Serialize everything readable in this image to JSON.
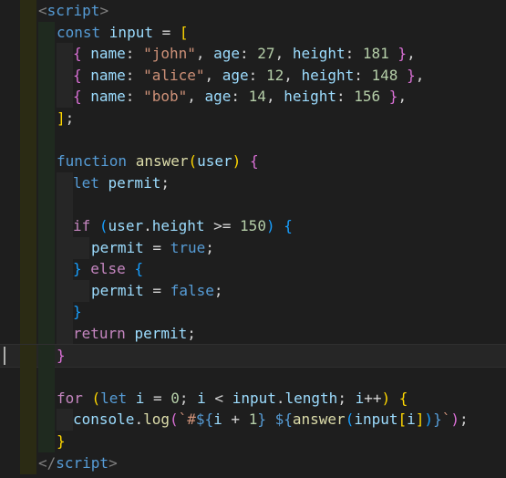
{
  "editor": {
    "lines": [
      {
        "tokens": [
          [
            "tag",
            "<"
          ],
          [
            "kw",
            "script"
          ],
          [
            "tag",
            ">"
          ]
        ]
      },
      {
        "tokens": [
          [
            "kw",
            "const "
          ],
          [
            "var",
            "input"
          ],
          [
            "op",
            " = "
          ],
          [
            "b1",
            "["
          ]
        ]
      },
      {
        "tokens": [
          [
            "b2",
            "{ "
          ],
          [
            "var",
            "name"
          ],
          [
            "op",
            ": "
          ],
          [
            "str",
            "\"john\""
          ],
          [
            "op",
            ", "
          ],
          [
            "var",
            "age"
          ],
          [
            "op",
            ": "
          ],
          [
            "num",
            "27"
          ],
          [
            "op",
            ", "
          ],
          [
            "var",
            "height"
          ],
          [
            "op",
            ": "
          ],
          [
            "num",
            "181"
          ],
          [
            "b2",
            " }"
          ],
          [
            "op",
            ","
          ]
        ]
      },
      {
        "tokens": [
          [
            "b2",
            "{ "
          ],
          [
            "var",
            "name"
          ],
          [
            "op",
            ": "
          ],
          [
            "str",
            "\"alice\""
          ],
          [
            "op",
            ", "
          ],
          [
            "var",
            "age"
          ],
          [
            "op",
            ": "
          ],
          [
            "num",
            "12"
          ],
          [
            "op",
            ", "
          ],
          [
            "var",
            "height"
          ],
          [
            "op",
            ": "
          ],
          [
            "num",
            "148"
          ],
          [
            "b2",
            " }"
          ],
          [
            "op",
            ","
          ]
        ]
      },
      {
        "tokens": [
          [
            "b2",
            "{ "
          ],
          [
            "var",
            "name"
          ],
          [
            "op",
            ": "
          ],
          [
            "str",
            "\"bob\""
          ],
          [
            "op",
            ", "
          ],
          [
            "var",
            "age"
          ],
          [
            "op",
            ": "
          ],
          [
            "num",
            "14"
          ],
          [
            "op",
            ", "
          ],
          [
            "var",
            "height"
          ],
          [
            "op",
            ": "
          ],
          [
            "num",
            "156"
          ],
          [
            "b2",
            " }"
          ],
          [
            "op",
            ","
          ]
        ]
      },
      {
        "tokens": [
          [
            "b1",
            "]"
          ],
          [
            "op",
            ";"
          ]
        ]
      },
      {
        "tokens": []
      },
      {
        "tokens": [
          [
            "kw",
            "function "
          ],
          [
            "fn",
            "answer"
          ],
          [
            "b1",
            "("
          ],
          [
            "var",
            "user"
          ],
          [
            "b1",
            ")"
          ],
          [
            "op",
            " "
          ],
          [
            "b2",
            "{"
          ]
        ]
      },
      {
        "tokens": [
          [
            "kw",
            "let "
          ],
          [
            "var",
            "permit"
          ],
          [
            "op",
            ";"
          ]
        ]
      },
      {
        "tokens": []
      },
      {
        "tokens": [
          [
            "ctrl",
            "if "
          ],
          [
            "b3",
            "("
          ],
          [
            "var",
            "user"
          ],
          [
            "op",
            "."
          ],
          [
            "var",
            "height"
          ],
          [
            "op",
            " >= "
          ],
          [
            "num",
            "150"
          ],
          [
            "b3",
            ")"
          ],
          [
            "op",
            " "
          ],
          [
            "b3",
            "{"
          ]
        ]
      },
      {
        "tokens": [
          [
            "var",
            "permit"
          ],
          [
            "op",
            " = "
          ],
          [
            "kw",
            "true"
          ],
          [
            "op",
            ";"
          ]
        ]
      },
      {
        "tokens": [
          [
            "b3",
            "}"
          ],
          [
            "op",
            " "
          ],
          [
            "ctrl",
            "else "
          ],
          [
            "b3",
            "{"
          ]
        ]
      },
      {
        "tokens": [
          [
            "var",
            "permit"
          ],
          [
            "op",
            " = "
          ],
          [
            "kw",
            "false"
          ],
          [
            "op",
            ";"
          ]
        ]
      },
      {
        "tokens": [
          [
            "b3",
            "}"
          ]
        ]
      },
      {
        "tokens": [
          [
            "ctrl",
            "return "
          ],
          [
            "var",
            "permit"
          ],
          [
            "op",
            ";"
          ]
        ]
      },
      {
        "tokens": [
          [
            "b2",
            "}"
          ]
        ]
      },
      {
        "tokens": []
      },
      {
        "tokens": [
          [
            "ctrl",
            "for "
          ],
          [
            "b1",
            "("
          ],
          [
            "kw",
            "let "
          ],
          [
            "var",
            "i"
          ],
          [
            "op",
            " = "
          ],
          [
            "num",
            "0"
          ],
          [
            "op",
            "; "
          ],
          [
            "var",
            "i"
          ],
          [
            "op",
            " < "
          ],
          [
            "var",
            "input"
          ],
          [
            "op",
            "."
          ],
          [
            "var",
            "length"
          ],
          [
            "op",
            "; "
          ],
          [
            "var",
            "i"
          ],
          [
            "op",
            "++"
          ],
          [
            "b1",
            ")"
          ],
          [
            "op",
            " "
          ],
          [
            "b1",
            "{"
          ]
        ]
      },
      {
        "tokens": [
          [
            "var",
            "console"
          ],
          [
            "op",
            "."
          ],
          [
            "fn",
            "log"
          ],
          [
            "b2",
            "("
          ],
          [
            "str",
            "`#"
          ],
          [
            "kw",
            "${"
          ],
          [
            "var",
            "i"
          ],
          [
            "op",
            " + "
          ],
          [
            "num",
            "1"
          ],
          [
            "kw",
            "}"
          ],
          [
            "str",
            " "
          ],
          [
            "kw",
            "${"
          ],
          [
            "fn",
            "answer"
          ],
          [
            "b3",
            "("
          ],
          [
            "var",
            "input"
          ],
          [
            "b1",
            "["
          ],
          [
            "var",
            "i"
          ],
          [
            "b1",
            "]"
          ],
          [
            "b3",
            ")"
          ],
          [
            "kw",
            "}"
          ],
          [
            "str",
            "`"
          ],
          [
            "b2",
            ")"
          ],
          [
            "op",
            ";"
          ]
        ]
      },
      {
        "tokens": [
          [
            "b1",
            "}"
          ]
        ]
      },
      {
        "tokens": [
          [
            "tag",
            "</"
          ],
          [
            "kw",
            "script"
          ],
          [
            "tag",
            ">"
          ]
        ]
      }
    ]
  }
}
